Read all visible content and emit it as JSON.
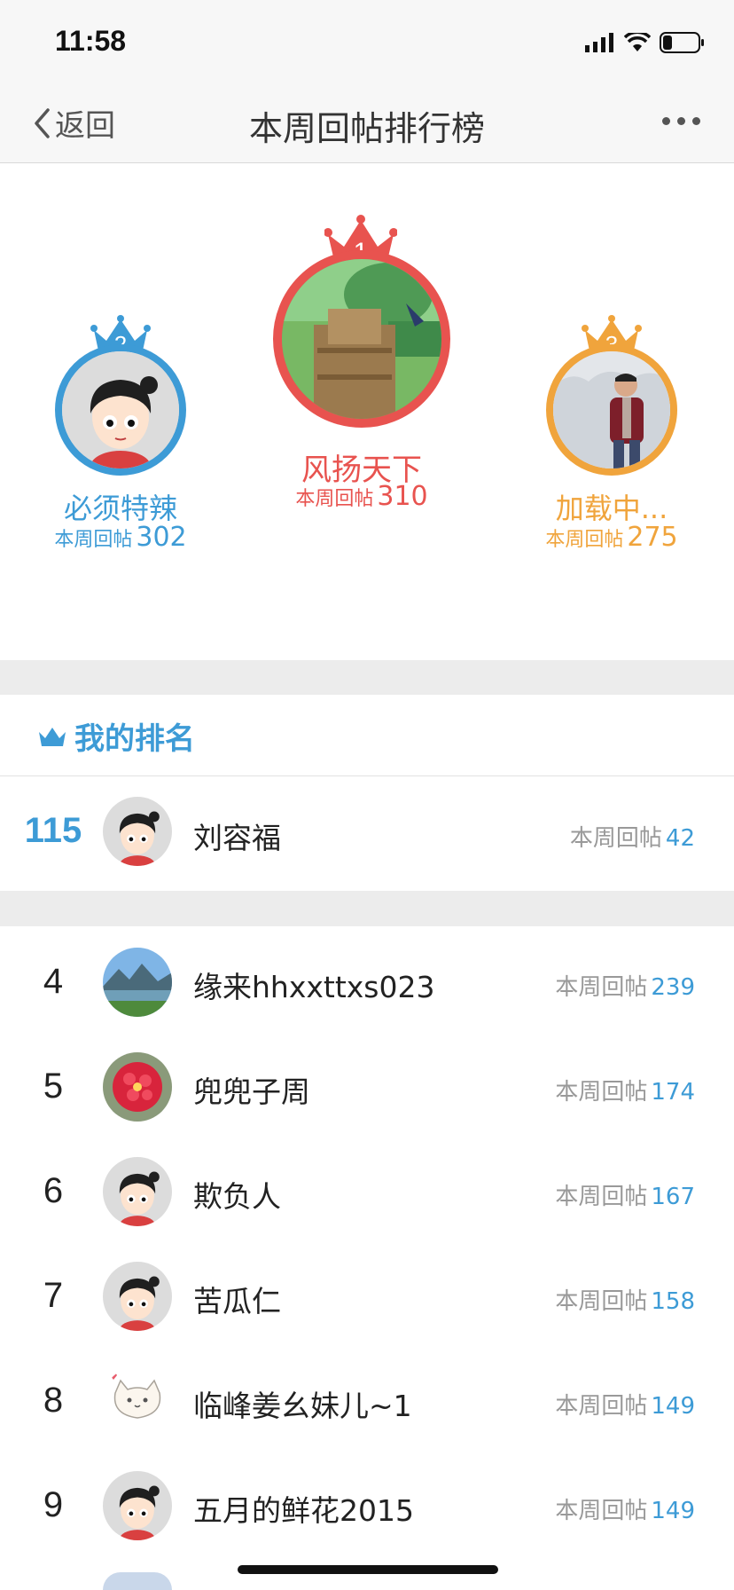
{
  "status": {
    "time": "11:58"
  },
  "nav": {
    "back_label": "返回",
    "title": "本周回帖排行榜"
  },
  "colors": {
    "first": "#e8534f",
    "second": "#3d9bd6",
    "third": "#f0a43c",
    "accent": "#3d9bd6"
  },
  "podium": {
    "first": {
      "rank": "1",
      "name": "风扬天下",
      "count_label": "本周回帖",
      "count": "310"
    },
    "second": {
      "rank": "2",
      "name": "必须特辣",
      "count_label": "本周回帖",
      "count": "302"
    },
    "third": {
      "rank": "3",
      "name": "加载中...",
      "count_label": "本周回帖",
      "count": "275"
    }
  },
  "my_rank": {
    "title": "我的排名",
    "rank": "115",
    "name": "刘容福",
    "count_label": "本周回帖",
    "count": "42"
  },
  "list": [
    {
      "rank": "4",
      "name": "缘来hhxxttxs023",
      "count_label": "本周回帖",
      "count": "239",
      "avatar": "landscape"
    },
    {
      "rank": "5",
      "name": "兜兜子周",
      "count_label": "本周回帖",
      "count": "174",
      "avatar": "flower"
    },
    {
      "rank": "6",
      "name": "欺负人",
      "count_label": "本周回帖",
      "count": "167",
      "avatar": "default-cartoon"
    },
    {
      "rank": "7",
      "name": "苦瓜仁",
      "count_label": "本周回帖",
      "count": "158",
      "avatar": "default-cartoon"
    },
    {
      "rank": "8",
      "name": "临峰姜幺妹儿~1",
      "count_label": "本周回帖",
      "count": "149",
      "avatar": "cat"
    },
    {
      "rank": "9",
      "name": "五月的鲜花2015",
      "count_label": "本周回帖",
      "count": "149",
      "avatar": "default-cartoon"
    }
  ]
}
